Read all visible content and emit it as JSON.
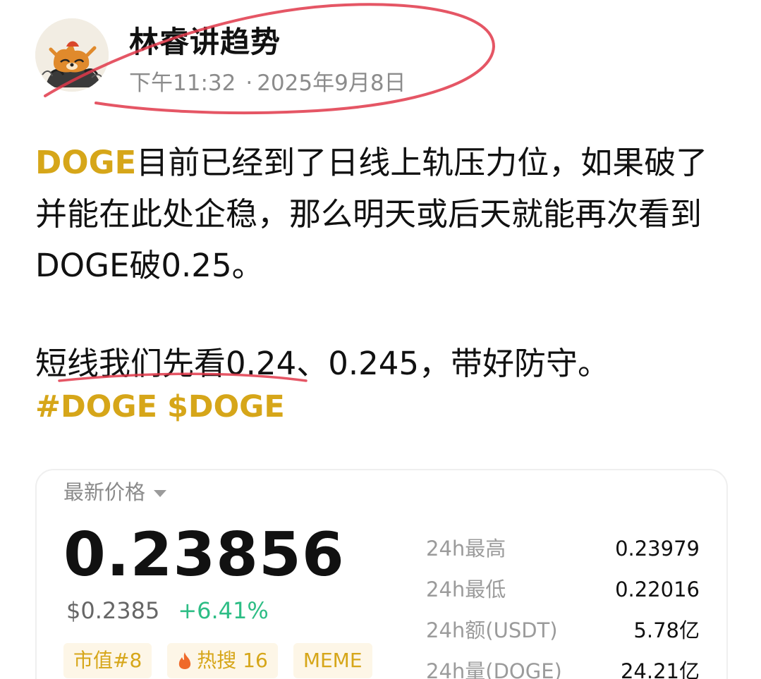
{
  "author": {
    "name": "林睿讲趋势",
    "time": "下午11:32",
    "separator": "·",
    "date": "2025年9月8日"
  },
  "post": {
    "paragraph1": {
      "highlight": "DOGE",
      "text": "目前已经到了日线上轨压力位，如果破了并能在此处企稳，那么明天或后天就能再次看到DOGE破0.25。"
    },
    "paragraph2": "短线我们先看0.24、0.245，带好防守。",
    "hashtags": [
      "#DOGE",
      "$DOGE"
    ]
  },
  "ticker_card": {
    "label": "最新价格",
    "price": "0.23856",
    "usd_price": "$0.2385",
    "change": "+6.41%",
    "tags": {
      "market_cap": "市值#8",
      "hot_search": "热搜 16",
      "category": "MEME"
    },
    "stats": [
      {
        "label": "24h最高",
        "value": "0.23979"
      },
      {
        "label": "24h最低",
        "value": "0.22016"
      },
      {
        "label": "24h额(USDT)",
        "value": "5.78亿"
      },
      {
        "label": "24h量(DOGE)",
        "value": "24.21亿"
      }
    ]
  },
  "colors": {
    "accent": "#d6a619",
    "positive": "#2dbd85",
    "annotation": "#e0384a",
    "muted": "#8c8c8c"
  },
  "icons": {
    "dropdown": "caret-down-icon",
    "hot": "fire-icon"
  }
}
